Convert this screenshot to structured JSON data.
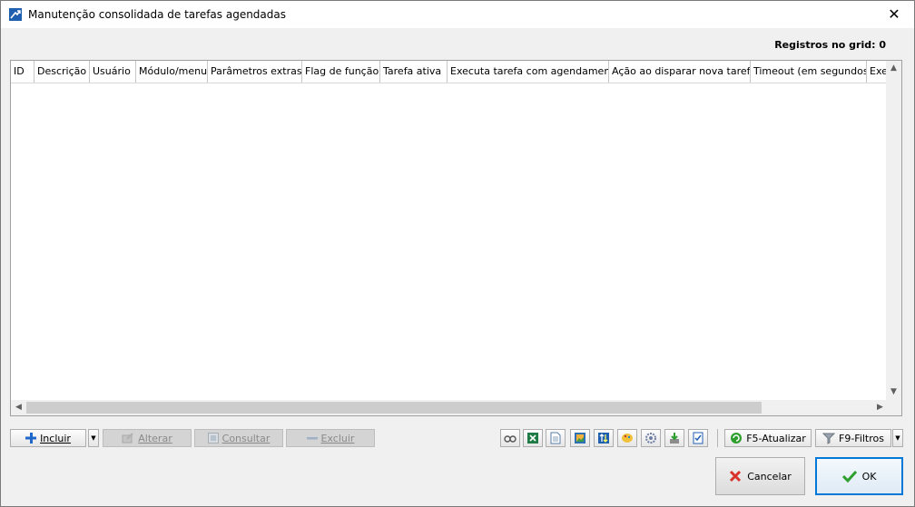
{
  "window": {
    "title": "Manutenção consolidada de tarefas agendadas",
    "close": "✕"
  },
  "grid": {
    "record_count": "Registros no grid: 0",
    "columns": [
      "ID",
      "Descrição",
      "Usuário",
      "Módulo/menu",
      "Parâmetros extras",
      "Flag de função",
      "Tarefa ativa",
      "Executa tarefa com agendamento",
      "Ação ao disparar nova tarefa",
      "Timeout (em segundos)",
      "Exec"
    ],
    "rows": []
  },
  "actions": {
    "incluir": "Incluir",
    "alterar": "Alterar",
    "consultar": "Consultar",
    "excluir": "Excluir"
  },
  "toolbar": {
    "f5": "F5-Atualizar",
    "f9": "F9-Filtros"
  },
  "footer": {
    "cancel": "Cancelar",
    "ok": "OK"
  },
  "colors": {
    "accent": "#0078d7",
    "ok_check": "#2e9e2e",
    "cancel_x": "#d9322b"
  }
}
